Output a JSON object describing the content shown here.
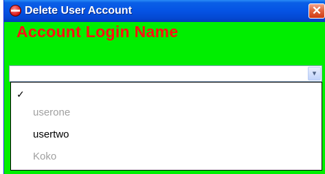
{
  "window": {
    "title": "Delete User Account",
    "close_glyph": "✕",
    "icon": "app-logo-icon"
  },
  "form": {
    "heading": "Account Login Name",
    "heading_color": "#ff1010",
    "background_color": "#00ee00"
  },
  "combo": {
    "selected_value": "",
    "arrow_glyph": "▾"
  },
  "dropdown": {
    "check_glyph": "✓",
    "options": [
      {
        "label": "",
        "checked": true,
        "enabled": true
      },
      {
        "label": "userone",
        "checked": false,
        "enabled": false
      },
      {
        "label": "usertwo",
        "checked": false,
        "enabled": true
      },
      {
        "label": "Koko",
        "checked": false,
        "enabled": false
      }
    ]
  }
}
